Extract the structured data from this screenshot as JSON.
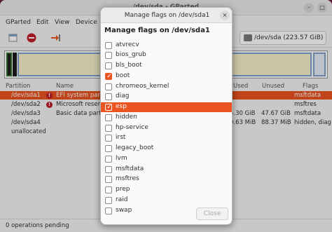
{
  "background_app": {
    "window_title": "/dev/sda - GParted",
    "menu": [
      "GParted",
      "Edit",
      "View",
      "Device"
    ],
    "device_selector": "/dev/sda  (223.57 GiB)",
    "columns": [
      "Partition",
      "Name",
      "Used",
      "Unused",
      "Flags"
    ],
    "rows": [
      {
        "partition": "/dev/sda1",
        "name": "EFI system part",
        "used": "",
        "unused": "",
        "flags": "msftdata",
        "warn": true,
        "selected": true
      },
      {
        "partition": "/dev/sda2",
        "name": "Microsoft reser",
        "used": "",
        "unused": "",
        "flags": "msftres",
        "warn": true,
        "selected": false
      },
      {
        "partition": "/dev/sda3",
        "name": "Basic data partit",
        "used": "5.30 GiB",
        "unused": "47.67 GiB",
        "flags": "msftdata",
        "warn": false,
        "selected": false
      },
      {
        "partition": "/dev/sda4",
        "name": "",
        "used": "0.63 MiB",
        "unused": "88.37 MiB",
        "flags": "hidden, diag",
        "warn": false,
        "selected": false
      },
      {
        "partition": "unallocated",
        "name": "",
        "used": "",
        "unused": "",
        "flags": "",
        "warn": false,
        "selected": false
      }
    ],
    "status": "0 operations pending",
    "warn_glyph": "!"
  },
  "dialog": {
    "title": "Manage flags on /dev/sda1",
    "heading": "Manage flags on /dev/sda1",
    "close_label": "Close",
    "close_glyph": "×",
    "check_glyph": "✓",
    "flags": [
      {
        "name": "atvrecv",
        "checked": false,
        "highlighted": false
      },
      {
        "name": "bios_grub",
        "checked": false,
        "highlighted": false
      },
      {
        "name": "bls_boot",
        "checked": false,
        "highlighted": false
      },
      {
        "name": "boot",
        "checked": true,
        "highlighted": false
      },
      {
        "name": "chromeos_kernel",
        "checked": false,
        "highlighted": false
      },
      {
        "name": "diag",
        "checked": false,
        "highlighted": false
      },
      {
        "name": "esp",
        "checked": true,
        "highlighted": true
      },
      {
        "name": "hidden",
        "checked": false,
        "highlighted": false
      },
      {
        "name": "hp-service",
        "checked": false,
        "highlighted": false
      },
      {
        "name": "irst",
        "checked": false,
        "highlighted": false
      },
      {
        "name": "legacy_boot",
        "checked": false,
        "highlighted": false
      },
      {
        "name": "lvm",
        "checked": false,
        "highlighted": false
      },
      {
        "name": "msftdata",
        "checked": false,
        "highlighted": false
      },
      {
        "name": "msftres",
        "checked": false,
        "highlighted": false
      },
      {
        "name": "prep",
        "checked": false,
        "highlighted": false
      },
      {
        "name": "raid",
        "checked": false,
        "highlighted": false
      },
      {
        "name": "swap",
        "checked": false,
        "highlighted": false
      }
    ]
  },
  "colors": {
    "accent": "#e95420",
    "desktop": "#6a2040",
    "error": "#c01c28"
  }
}
